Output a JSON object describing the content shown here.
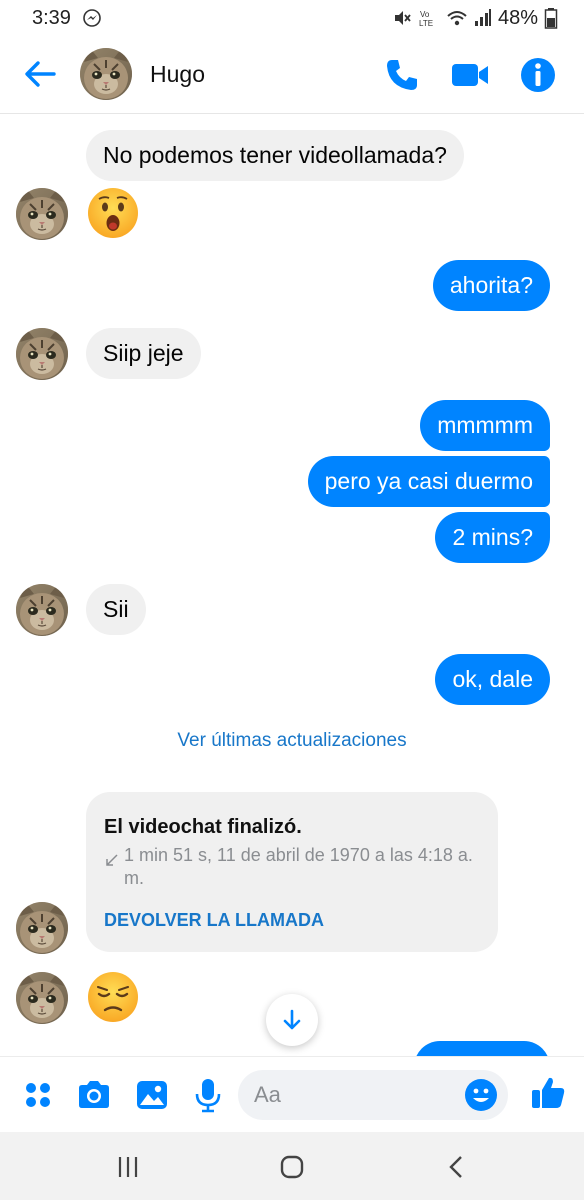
{
  "status_bar": {
    "time": "3:39",
    "left_icon": "messenger-notification-icon",
    "right_icons": [
      "mute-icon",
      "volte-icon",
      "wifi-icon",
      "signal-icon"
    ],
    "battery_text": "48%",
    "battery_icon": "battery-icon"
  },
  "header": {
    "back_icon": "back-arrow-icon",
    "contact_name": "Hugo",
    "actions": [
      "phone-call-icon",
      "video-call-icon",
      "info-icon"
    ],
    "accent_color": "#0084ff"
  },
  "messages": [
    {
      "sender": "contact",
      "type": "text",
      "text": "No podemos tener videollamada?"
    },
    {
      "sender": "contact",
      "type": "emoji",
      "emoji": "surprised-face-emoji"
    },
    {
      "sender": "me",
      "type": "text",
      "text": "ahorita?"
    },
    {
      "sender": "contact",
      "type": "text",
      "text": "Siip jeje"
    },
    {
      "sender": "me",
      "type": "text",
      "text": "mmmmm"
    },
    {
      "sender": "me",
      "type": "text",
      "text": "pero ya casi duermo"
    },
    {
      "sender": "me",
      "type": "text",
      "text": "2 mins?"
    },
    {
      "sender": "contact",
      "type": "text",
      "text": "Sii"
    },
    {
      "sender": "me",
      "type": "text",
      "text": "ok, dale"
    },
    {
      "sender": "contact",
      "type": "emoji",
      "emoji": "pensive-face-emoji"
    }
  ],
  "updates_link": "Ver últimas actualizaciones",
  "call_card": {
    "title": "El videochat finalizó.",
    "detail": "1 min 51 s, 11 de abril de 1970 a las 4:18 a. m.",
    "detail_icon": "missed-call-arrow-icon",
    "action": "DEVOLVER LA LLAMADA"
  },
  "scroll_button_icon": "arrow-down-icon",
  "composer": {
    "icons": [
      "menu-dots-icon",
      "camera-icon",
      "gallery-icon",
      "microphone-icon"
    ],
    "placeholder": "Aa",
    "emoji_icon": "smiley-icon",
    "send_icon": "thumbs-up-icon"
  },
  "nav_bar": {
    "buttons": [
      "recent-apps-icon",
      "home-icon",
      "back-icon"
    ]
  },
  "colors": {
    "outgoing_bubble": "#0084ff",
    "incoming_bubble": "#f0f0f0",
    "link": "#1877c9"
  }
}
